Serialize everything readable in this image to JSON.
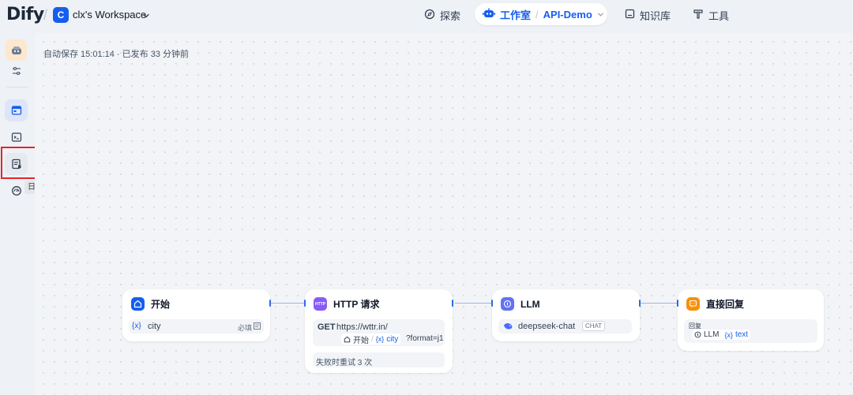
{
  "header": {
    "logo": "Dify",
    "workspace_badge": "C",
    "workspace_name": "clx's Workspace",
    "nav": {
      "explore": "探索",
      "studio": "工作室",
      "separator": "/",
      "current_app": "API-Demo",
      "knowledge": "知识库",
      "tools": "工具"
    }
  },
  "sidebar": {
    "tooltip": "日志与标注",
    "icons": [
      "app-icon",
      "config-icon",
      "overview-icon",
      "api-console-icon",
      "logs-annotations-icon",
      "monitoring-icon"
    ]
  },
  "status": {
    "autosave": "自动保存 15:01:14 · 已发布 33 分钟前"
  },
  "nodes": {
    "start": {
      "title": "开始",
      "var_prefix": "{x}",
      "var_name": "city",
      "required": "必填"
    },
    "http": {
      "badge": "HTTP",
      "title": "HTTP 请求",
      "method": "GET",
      "url": "https://wttr.in/",
      "ref_node": "开始",
      "ref_sep": "/",
      "ref_prefix": "{x}",
      "ref_var": "city",
      "url_suffix": "?format=j1",
      "retry": "失败时重试 3 次"
    },
    "llm": {
      "title": "LLM",
      "model": "deepseek-chat",
      "mode": "CHAT"
    },
    "answer": {
      "title": "直接回复",
      "label": "回复",
      "ref_node": "LLM",
      "ref_prefix": "{x}",
      "ref_var": "text"
    }
  },
  "colors": {
    "accent": "#155EEF",
    "http_node": "#875BF7",
    "llm_node": "#6172F3",
    "answer_node": "#F79009",
    "highlight_box": "#E5252A"
  }
}
